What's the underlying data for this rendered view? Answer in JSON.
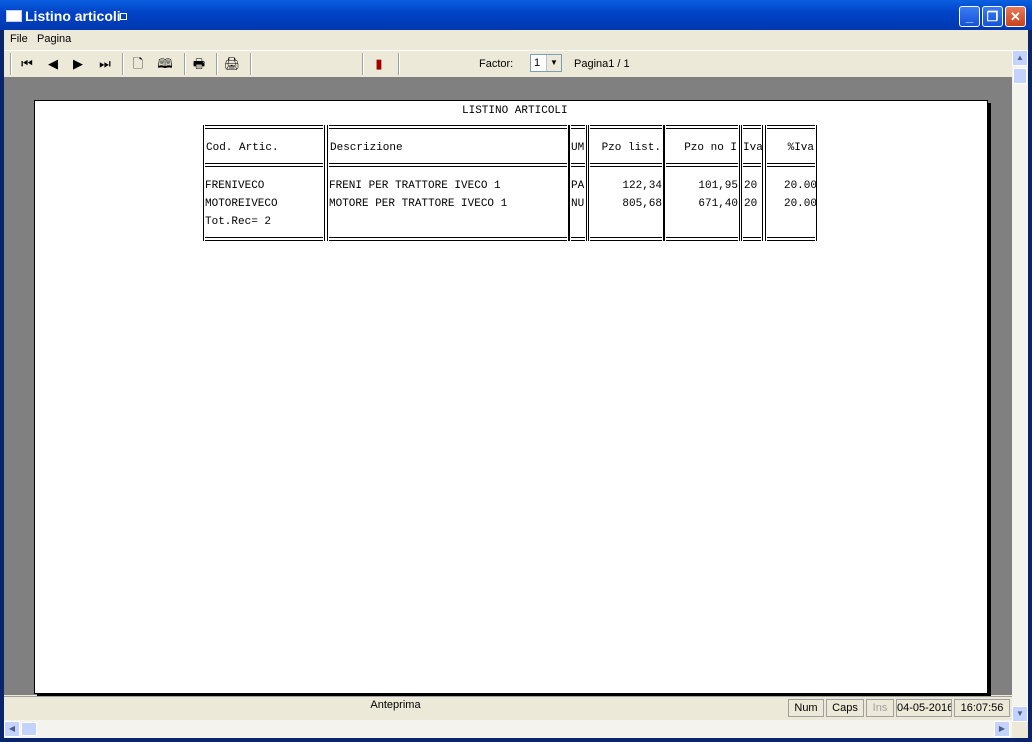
{
  "window": {
    "title": "Listino articoli"
  },
  "menu": [
    "File",
    "Pagina"
  ],
  "toolbar": {
    "factor_label": "Factor:",
    "factor_value": "1",
    "page_label": "Pagina1 / 1"
  },
  "report": {
    "title": "LISTINO ARTICOLI",
    "columns": [
      "Cod. Artic.",
      "Descrizione",
      "UM",
      "Pzo list.",
      "Pzo no I",
      "Iva",
      "%Iva"
    ],
    "rows": [
      [
        "FRENIVECO",
        "FRENI PER TRATTORE IVECO 1",
        "PA",
        "122,34",
        "101,95",
        "20",
        "20.00"
      ],
      [
        "MOTOREIVECO",
        "MOTORE PER TRATTORE IVECO 1",
        "NU",
        "805,68",
        "671,40",
        "20",
        "20.00"
      ]
    ],
    "total": "Tot.Rec= 2"
  },
  "status": {
    "main": "Anteprima",
    "num": "Num",
    "caps": "Caps",
    "ins": "Ins",
    "date": "04-05-2016",
    "time": "16:07:56"
  }
}
